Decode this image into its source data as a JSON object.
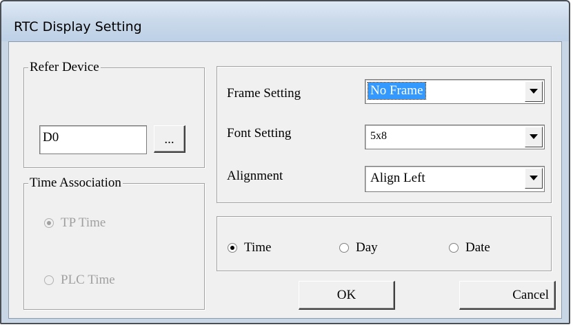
{
  "window": {
    "title": "RTC Display Setting"
  },
  "refer_device": {
    "legend": "Refer Device",
    "value": "D0",
    "browse_label": "..."
  },
  "time_association": {
    "legend": "Time Association",
    "options": [
      {
        "label": "TP Time",
        "checked": true
      },
      {
        "label": "PLC Time",
        "checked": false
      }
    ]
  },
  "settings": {
    "frame_label": "Frame Setting",
    "frame_value": "No Frame",
    "font_label": "Font Setting",
    "font_value": "5x8",
    "alignment_label": "Alignment",
    "alignment_value": "Align Left"
  },
  "display_mode": {
    "options": [
      {
        "label": "Time",
        "checked": true
      },
      {
        "label": "Day",
        "checked": false
      },
      {
        "label": "Date",
        "checked": false
      }
    ]
  },
  "buttons": {
    "ok": "OK",
    "cancel": "Cancel"
  }
}
